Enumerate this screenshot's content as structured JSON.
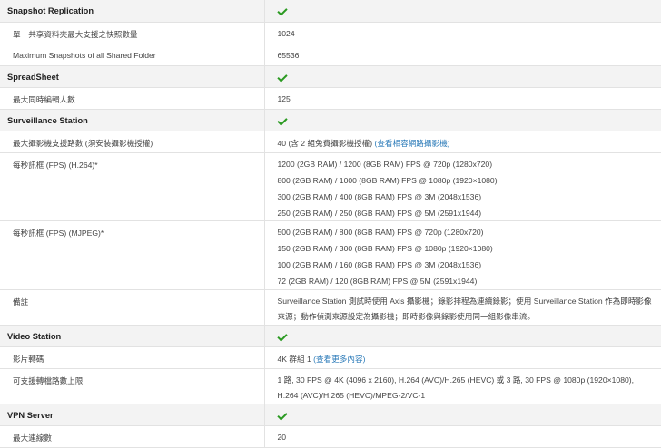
{
  "sections": [
    {
      "title": "Snapshot Replication",
      "rows": [
        {
          "label": "單一共享資料夾最大支援之快照數量",
          "value": "1024"
        },
        {
          "label": "Maximum Snapshots of all Shared Folder",
          "value": "65536"
        }
      ]
    },
    {
      "title": "SpreadSheet",
      "rows": [
        {
          "label": "最大同時編輯人數",
          "value": "125"
        }
      ]
    },
    {
      "title": "Surveillance Station",
      "rows": [
        {
          "label": "最大攝影機支援路數 (須安裝攝影機授權)",
          "value": "40 (含 2 組免費攝影機授權) ",
          "link": "(查看相容網路攝影機)"
        },
        {
          "label": "每秒訊框 (FPS) (H.264)*",
          "lines": [
            "1200 (2GB RAM) / 1200 (8GB RAM) FPS @ 720p (1280x720)",
            "800 (2GB RAM) / 1000 (8GB RAM) FPS @ 1080p (1920×1080)",
            "300 (2GB RAM) / 400 (8GB RAM) FPS @ 3M (2048x1536)",
            "250 (2GB RAM) / 250 (8GB RAM) FPS @ 5M (2591x1944)"
          ]
        },
        {
          "label": "每秒訊框 (FPS) (MJPEG)*",
          "lines": [
            "500 (2GB RAM) / 800 (8GB RAM) FPS @ 720p (1280x720)",
            "150 (2GB RAM) / 300 (8GB RAM) FPS @ 1080p (1920×1080)",
            "100 (2GB RAM) / 160 (8GB RAM) FPS @ 3M (2048x1536)",
            "72 (2GB RAM) / 120 (8GB RAM) FPS @ 5M (2591x1944)"
          ]
        },
        {
          "label": "備註",
          "value": "Surveillance Station 測試時使用 Axis 攝影機；錄影排程為連續錄影；使用 Surveillance Station 作為即時影像來源；動作偵測來源設定為攝影機；即時影像與錄影使用同一組影像串流。"
        }
      ]
    },
    {
      "title": "Video Station",
      "rows": [
        {
          "label": "影片轉碼",
          "value": "4K 群組 1 ",
          "link": "(查看更多內容)"
        },
        {
          "label": "可支援轉檔路數上限",
          "value": "1 路, 30 FPS @ 4K (4096 x 2160), H.264 (AVC)/H.265 (HEVC) 或 3 路, 30 FPS @ 1080p (1920×1080), H.264 (AVC)/H.265 (HEVC)/MPEG-2/VC-1"
        }
      ]
    },
    {
      "title": "VPN Server",
      "rows": [
        {
          "label": "最大連線數",
          "value": "20"
        }
      ]
    }
  ],
  "colors": {
    "check": "#2b9a22",
    "link": "#2a7ab8",
    "header_bg": "#f3f3f3"
  }
}
